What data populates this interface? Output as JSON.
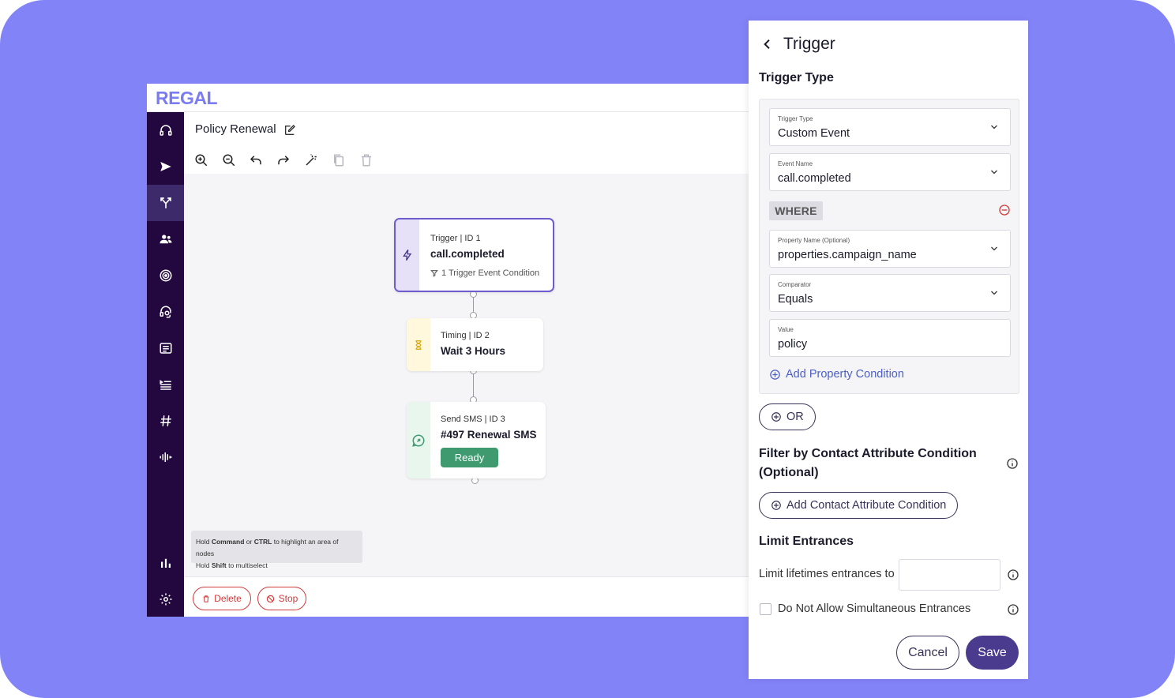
{
  "app": {
    "logo": "REGAL",
    "flow_title": "Policy Renewal"
  },
  "sidebar": {
    "items": [
      {
        "icon": "headset-icon"
      },
      {
        "icon": "send-icon"
      },
      {
        "icon": "journey-branch-icon",
        "active": true
      },
      {
        "icon": "contacts-icon"
      },
      {
        "icon": "target-icon"
      },
      {
        "icon": "agent-support-icon"
      },
      {
        "icon": "list-card-icon"
      },
      {
        "icon": "queue-list-icon"
      },
      {
        "icon": "hashtag-icon"
      },
      {
        "icon": "audio-wave-icon"
      },
      {
        "icon": "bar-chart-icon"
      },
      {
        "icon": "settings-gear-icon"
      }
    ]
  },
  "toolbar": {
    "icons": [
      "zoom-in-icon",
      "zoom-out-icon",
      "undo-icon",
      "redo-icon",
      "magic-wand-icon",
      "copy-icon",
      "trash-icon"
    ]
  },
  "nodes": [
    {
      "meta": "Trigger | ID 1",
      "name": "call.completed",
      "sub": "1 Trigger Event Condition",
      "icon": "lightning-icon"
    },
    {
      "meta": "Timing | ID 2",
      "name": "Wait 3 Hours",
      "icon": "hourglass-icon"
    },
    {
      "meta": "Send SMS | ID 3",
      "name": "#497 Renewal SMS",
      "status": "Ready",
      "icon": "sms-bubble-icon"
    }
  ],
  "hint": {
    "line1_pre": "Hold ",
    "line1_b1": "Command",
    "line1_mid": " or ",
    "line1_b2": "CTRL",
    "line1_post": " to highlight an area of nodes",
    "line2_pre": "Hold ",
    "line2_b": "Shift",
    "line2_post": " to multiselect"
  },
  "footer": {
    "delete_label": "Delete",
    "stop_label": "Stop"
  },
  "panel": {
    "title": "Trigger",
    "trigger_type_heading": "Trigger Type",
    "fields": {
      "trigger_type": {
        "label": "Trigger Type",
        "value": "Custom Event"
      },
      "event_name": {
        "label": "Event Name",
        "value": "call.completed"
      },
      "property_name": {
        "label": "Property Name (Optional)",
        "value": "properties.campaign_name"
      },
      "comparator": {
        "label": "Comparator",
        "value": "Equals"
      },
      "value": {
        "label": "Value",
        "value": "policy"
      }
    },
    "where_label": "WHERE",
    "add_property_condition": "Add Property Condition",
    "or_label": "OR",
    "filter_heading_line1": "Filter by Contact Attribute Condition",
    "filter_heading_line2": "(Optional)",
    "add_contact_attribute_condition": "Add Contact Attribute Condition",
    "limit_heading": "Limit Entrances",
    "limit_label": "Limit lifetimes entrances to",
    "limit_value": "",
    "simultaneous_label": "Do Not Allow Simultaneous Entrances",
    "simultaneous_checked": false,
    "cancel_label": "Cancel",
    "save_label": "Save"
  },
  "colors": {
    "background": "#8383f8",
    "sidebar": "#23083f",
    "accent": "#6c5ccf",
    "ready": "#3f9a70",
    "danger": "#d13b3b",
    "primary_button": "#4b3b8f",
    "link": "#4b5fc7"
  }
}
